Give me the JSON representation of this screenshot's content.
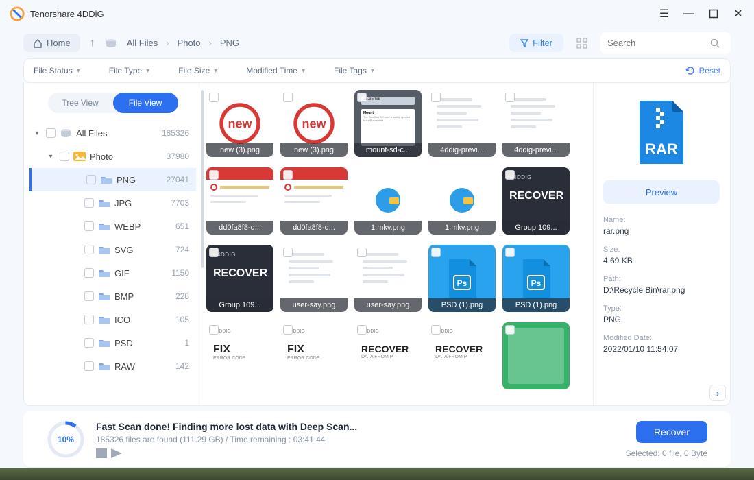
{
  "app": {
    "title": "Tenorshare 4DDiG"
  },
  "toolbar": {
    "home": "Home",
    "crumbs": [
      "All Files",
      "Photo",
      "PNG"
    ],
    "filter": "Filter",
    "search_placeholder": "Search"
  },
  "filters": {
    "items": [
      "File Status",
      "File Type",
      "File Size",
      "Modified Time",
      "File Tags"
    ],
    "reset": "Reset"
  },
  "view_switch": {
    "tree": "Tree View",
    "file": "File View"
  },
  "tree": {
    "root": {
      "label": "All Files",
      "count": "185326"
    },
    "photo": {
      "label": "Photo",
      "count": "37980"
    },
    "children": [
      {
        "label": "PNG",
        "count": "27041",
        "selected": true
      },
      {
        "label": "JPG",
        "count": "7703"
      },
      {
        "label": "WEBP",
        "count": "651"
      },
      {
        "label": "SVG",
        "count": "724"
      },
      {
        "label": "GIF",
        "count": "1150"
      },
      {
        "label": "BMP",
        "count": "228"
      },
      {
        "label": "ICO",
        "count": "105"
      },
      {
        "label": "PSD",
        "count": "1"
      },
      {
        "label": "RAW",
        "count": "142"
      }
    ]
  },
  "thumbs": [
    {
      "label": "new (3).png",
      "kind": "new"
    },
    {
      "label": "new (3).png",
      "kind": "new"
    },
    {
      "label": "mount-sd-c...",
      "kind": "browser"
    },
    {
      "label": "4ddig-previ...",
      "kind": "lighttext"
    },
    {
      "label": "4ddig-previ...",
      "kind": "lighttext"
    },
    {
      "label": "dd0fa8f8-d...",
      "kind": "redapp"
    },
    {
      "label": "dd0fa8f8-d...",
      "kind": "redapp"
    },
    {
      "label": "1.mkv.png",
      "kind": "duck"
    },
    {
      "label": "1.mkv.png",
      "kind": "duck"
    },
    {
      "label": "Group 109...",
      "kind": "recover"
    },
    {
      "label": "Group 109...",
      "kind": "recover"
    },
    {
      "label": "user-say.png",
      "kind": "lighttext"
    },
    {
      "label": "user-say.png",
      "kind": "lighttext"
    },
    {
      "label": "PSD (1).png",
      "kind": "ps"
    },
    {
      "label": "PSD (1).png",
      "kind": "ps"
    },
    {
      "label": "",
      "kind": "fix"
    },
    {
      "label": "",
      "kind": "fix"
    },
    {
      "label": "",
      "kind": "recover2"
    },
    {
      "label": "",
      "kind": "recover2"
    },
    {
      "label": "",
      "kind": "green"
    }
  ],
  "thumb_text": {
    "recover_brand": "4DDIG",
    "recover_big": "RECOVER",
    "fix_big": "FIX",
    "fix_sub": "ERROR CODE"
  },
  "preview": {
    "button": "Preview",
    "labels": {
      "name": "Name:",
      "size": "Size:",
      "path": "Path:",
      "type": "Type:",
      "mod": "Modified Date:"
    },
    "name": "rar.png",
    "size": "4.69 KB",
    "path": "D:\\Recycle Bin\\rar.png",
    "type": "PNG",
    "mod": "2022/01/10 11:54:07",
    "rar_label": "RAR"
  },
  "footer": {
    "percent": "10%",
    "title": "Fast Scan done! Finding more lost data with Deep Scan...",
    "sub": "185326 files are found (111.29 GB)  /  Time remaining : 03:41:44",
    "recover": "Recover",
    "selected": "Selected: 0 file, 0 Byte"
  }
}
